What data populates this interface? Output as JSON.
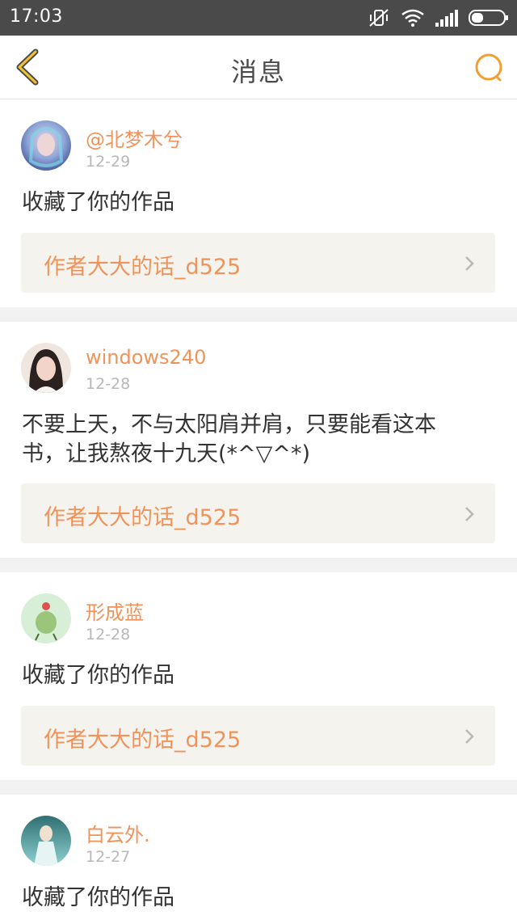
{
  "status_bar": {
    "time": "17:03",
    "icons": [
      "mute-vibrate-icon",
      "wifi-icon",
      "signal-icon",
      "battery-icon"
    ]
  },
  "header": {
    "title": "消息",
    "back_icon": "chevron-left-icon",
    "search_icon": "search-icon",
    "accent_color": "#f0a030"
  },
  "messages": [
    {
      "user": "@北梦木兮",
      "date": "12-29",
      "text": "收藏了你的作品",
      "work_title": "作者大大的话_d525"
    },
    {
      "user": "windows240",
      "date": "12-28",
      "text": "不要上天，不与太阳肩并肩，只要能看这本书，让我熬夜十九天(*^▽^*)",
      "work_title": "作者大大的话_d525"
    },
    {
      "user": "形成蓝",
      "date": "12-28",
      "text": "收藏了你的作品",
      "work_title": "作者大大的话_d525"
    },
    {
      "user": "白云外.",
      "date": "12-27",
      "text": "收藏了你的作品",
      "work_title": ""
    }
  ],
  "colors": {
    "name": "#f0935a",
    "work_bg": "#f4f3ee",
    "separator": "#f2f2f2"
  }
}
